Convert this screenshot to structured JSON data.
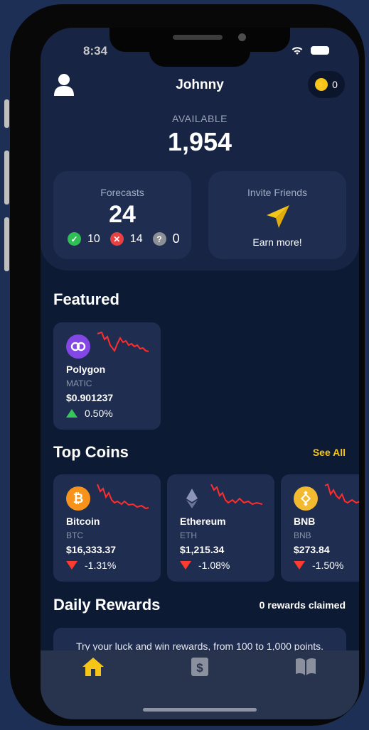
{
  "status_bar": {
    "time": "8:34"
  },
  "header": {
    "username": "Johnny",
    "points_badge": "0"
  },
  "balance": {
    "label": "AVAILABLE",
    "value": "1,954"
  },
  "forecasts": {
    "title": "Forecasts",
    "total": "24",
    "correct": "10",
    "wrong": "14",
    "pending": "0"
  },
  "invite": {
    "title": "Invite Friends",
    "subtitle": "Earn more!"
  },
  "featured": {
    "title": "Featured",
    "coin": {
      "name": "Polygon",
      "symbol": "MATIC",
      "price": "$0.901237",
      "change": "0.50%",
      "direction": "up",
      "color": "#8247e5",
      "icon": "polygon-logo-icon"
    }
  },
  "top_coins": {
    "title": "Top Coins",
    "see_all": "See All",
    "coins": [
      {
        "name": "Bitcoin",
        "symbol": "BTC",
        "price": "$16,333.37",
        "change": "-1.31%",
        "direction": "down",
        "color": "#f7931a",
        "icon": "bitcoin-logo-icon"
      },
      {
        "name": "Ethereum",
        "symbol": "ETH",
        "price": "$1,215.34",
        "change": "-1.08%",
        "direction": "down",
        "color": "#627eea",
        "icon": "ethereum-logo-icon"
      },
      {
        "name": "BNB",
        "symbol": "BNB",
        "price": "$273.84",
        "change": "-1.50%",
        "direction": "down",
        "color": "#f3ba2f",
        "icon": "bnb-logo-icon"
      }
    ]
  },
  "daily_rewards": {
    "title": "Daily Rewards",
    "claimed": "0 rewards claimed",
    "text": "Try your luck and win rewards, from 100 to 1,000 points."
  },
  "tabs": [
    {
      "icon": "home-icon",
      "active": true
    },
    {
      "icon": "dollar-icon",
      "active": false
    },
    {
      "icon": "book-icon",
      "active": false
    }
  ],
  "colors": {
    "accent": "#f5c518",
    "background": "#0d1a33",
    "card": "#1f2d50",
    "up": "#34c759",
    "down": "#ff3b30"
  }
}
